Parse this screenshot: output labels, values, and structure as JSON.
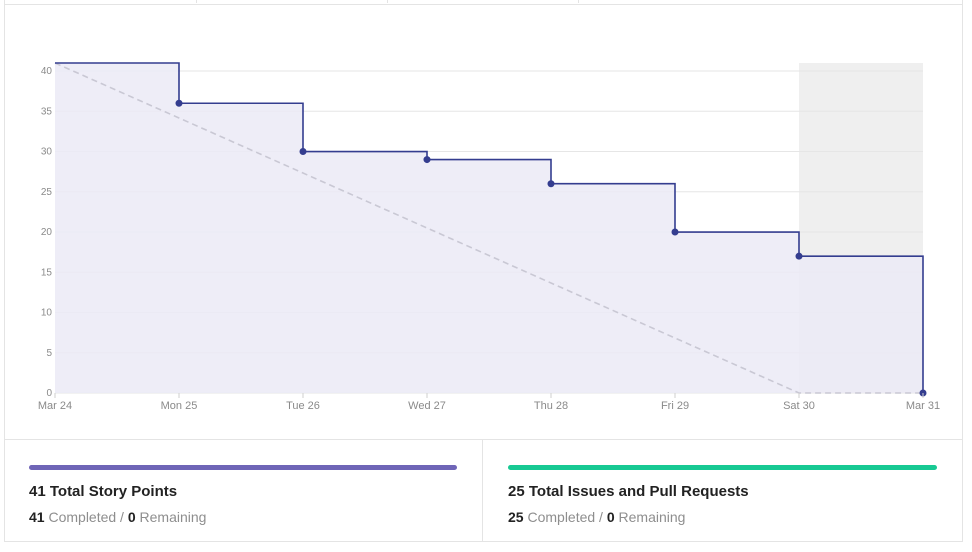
{
  "chart_data": {
    "type": "line",
    "x": [
      "Mar 24",
      "Mon 25",
      "Tue 26",
      "Wed 27",
      "Thu 28",
      "Fri 29",
      "Sat 30",
      "Mar 31"
    ],
    "y_ticks": [
      0,
      5,
      10,
      15,
      20,
      25,
      30,
      35,
      40
    ],
    "ylim": [
      0,
      41
    ],
    "series": [
      {
        "kind": "actual-step",
        "values": [
          41,
          36,
          30,
          29,
          26,
          20,
          17,
          0
        ],
        "color": "#343d8f"
      },
      {
        "kind": "ideal-guideline",
        "values": [
          41,
          34.17,
          27.33,
          20.5,
          13.67,
          6.83,
          0,
          0
        ],
        "color": "#c9c8d4"
      }
    ],
    "shaded_range": [
      "Sat 30",
      "Mar 31"
    ],
    "grid": true,
    "fill_color": "#ebeaf6",
    "shade_color": "#efefef"
  },
  "stats": [
    {
      "total_title": "41 Total Story Points",
      "completed": "41",
      "completed_label": "Completed /",
      "remaining": "0",
      "remaining_label": "Remaining",
      "bar_color": "#6f65b7"
    },
    {
      "total_title": "25 Total Issues and Pull Requests",
      "completed": "25",
      "completed_label": "Completed /",
      "remaining": "0",
      "remaining_label": "Remaining",
      "bar_color": "#17c993"
    }
  ]
}
